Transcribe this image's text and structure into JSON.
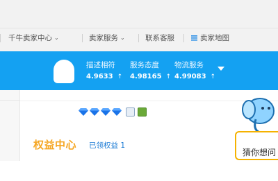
{
  "topnav": {
    "items": [
      {
        "label": "千牛卖家中心",
        "has_dropdown": true
      },
      {
        "label": "卖家服务",
        "has_dropdown": true
      },
      {
        "label": "联系客服",
        "has_dropdown": false
      },
      {
        "label": "卖家地图",
        "has_dropdown": false,
        "icon": "menu-icon"
      }
    ],
    "chevron": "⌄"
  },
  "shop_header": {
    "scores": [
      {
        "label": "描述相符",
        "value": "4.9633",
        "trend": "↑"
      },
      {
        "label": "服务态度",
        "value": "4.98165",
        "trend": "↑"
      },
      {
        "label": "物流服务",
        "value": "4.99083",
        "trend": "↑"
      }
    ],
    "colors": {
      "band": "#14a1f2",
      "text": "#ffffff"
    }
  },
  "credit": {
    "diamond_count": 4,
    "diamond_color": "#1a73e8",
    "badges": [
      "id-verified-badge-icon",
      "gold-seller-badge-icon"
    ]
  },
  "rights": {
    "title": "权益中心",
    "claimed": "已领权益 1"
  },
  "helper": {
    "text": "猜你想问",
    "icon": "elephant-mascot-icon"
  }
}
